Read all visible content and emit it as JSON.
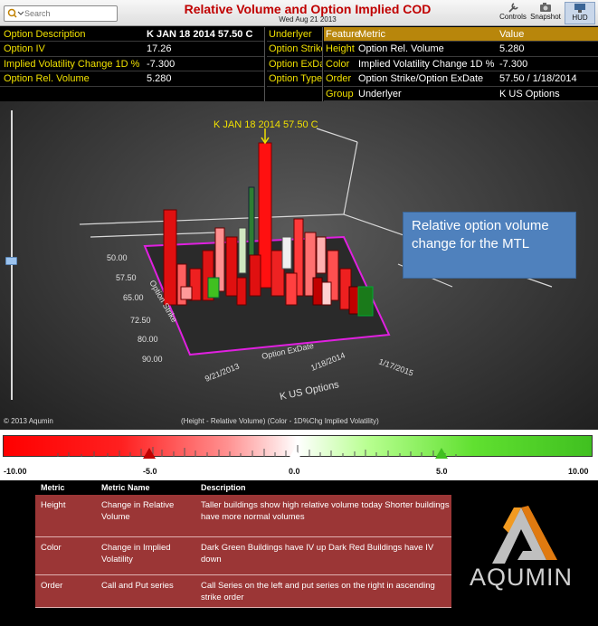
{
  "toolbar": {
    "search_placeholder": "Search",
    "title": "Relative Volume and Option Implied COD",
    "date": "Wed Aug 21 2013",
    "controls_label": "Controls",
    "snapshot_label": "Snapshot",
    "hud_label": "HUD"
  },
  "info_left": [
    {
      "label": "Option Description",
      "value": "K JAN 18 2014 57.50 C"
    },
    {
      "label": "Option IV",
      "value": "17.26"
    },
    {
      "label": "Implied Volatility Change 1D %",
      "value": "-7.300"
    },
    {
      "label": "Option Rel. Volume",
      "value": "5.280"
    }
  ],
  "info_mid": [
    "Underlyer",
    "Option Strike",
    "Option ExDate",
    "Option Type"
  ],
  "info_right": {
    "headers": [
      "Feature",
      "Metric",
      "Value"
    ],
    "rows": [
      {
        "feature": "Height",
        "metric": "Option Rel. Volume",
        "value": "5.280"
      },
      {
        "feature": "Color",
        "metric": "Implied Volatility Change 1D %",
        "value": "-7.300"
      },
      {
        "feature": "Order",
        "metric": "Option Strike/Option ExDate",
        "value": "57.50 / 1/18/2014"
      },
      {
        "feature": "Group",
        "metric": "Underlyer",
        "value": "K US Options"
      }
    ]
  },
  "viz": {
    "focus_label": "K JAN 18 2014 57.50 C",
    "callout": "Relative option volume change for the MTL",
    "strike_axis_title": "Option Strike",
    "strike_ticks": [
      "50.00",
      "57.50",
      "65.00",
      "72.50",
      "80.00",
      "90.00"
    ],
    "exdate_axis_title": "Option ExDate",
    "exdate_ticks": [
      "9/21/2013",
      "1/18/2014",
      "1/17/2015"
    ],
    "group_label": "K US Options",
    "copyright": "© 2013 Aqumin",
    "legend_caption": "(Height - Relative Volume) (Color - 1D%Chg Implied Volatility)"
  },
  "scale": {
    "labels": [
      "-10.00",
      "-5.0",
      "0.0",
      "5.0",
      "10.00"
    ],
    "min": -10,
    "max": 10,
    "colors": {
      "negative": "#ff0000",
      "neutral": "#ffffff",
      "positive": "#40c020"
    }
  },
  "description": {
    "headers": [
      "Metric",
      "Metric Name",
      "Description"
    ],
    "rows": [
      {
        "metric": "Height",
        "name": "Change in Relative Volume",
        "description": "Taller buildings show high relative volume today Shorter buildings have more normal volumes"
      },
      {
        "metric": "Color",
        "name": "Change in Implied Volatility",
        "description": "Dark Green Buildings have IV up Dark Red Buildings have IV down"
      },
      {
        "metric": "Order",
        "name": "Call and Put series",
        "description": "Call Series on the left and put series on the right in ascending strike order"
      }
    ]
  },
  "logo": {
    "text": "AQUMIN"
  }
}
